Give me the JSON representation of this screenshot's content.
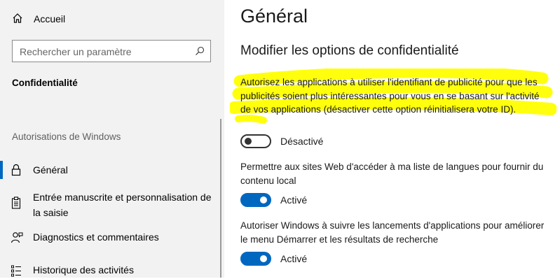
{
  "sidebar": {
    "home_label": "Accueil",
    "search_placeholder": "Rechercher un paramètre",
    "section_title": "Confidentialité",
    "group_title": "Autorisations de Windows",
    "items": [
      {
        "label": "Général",
        "icon": "lock-icon",
        "active": true
      },
      {
        "label": "Entrée manuscrite et personnalisation de la saisie",
        "icon": "clipboard-icon"
      },
      {
        "label": "Diagnostics et commentaires",
        "icon": "feedback-person-icon"
      },
      {
        "label": "Historique des activités",
        "icon": "activity-history-icon"
      }
    ]
  },
  "main": {
    "title": "Général",
    "subtitle": "Modifier les options de confidentialité",
    "options": [
      {
        "description": "Autorisez les applications à utiliser l'identifiant de publicité pour que les publicités soient plus intéressantes pour vous en se basant sur l'activité de vos applications (désactiver cette option réinitialisera votre ID).",
        "state_label": "Désactivé",
        "on": false,
        "highlighted": true
      },
      {
        "description": "Permettre aux sites Web d'accéder à ma liste de langues pour fournir du contenu local",
        "state_label": "Activé",
        "on": true
      },
      {
        "description": "Autoriser Windows à suivre les lancements d'applications pour améliorer le menu Démarrer et les résultats de recherche",
        "state_label": "Activé",
        "on": true
      }
    ]
  },
  "colors": {
    "accent": "#0067c0",
    "highlight": "#ffff00",
    "sidebar_bg": "#f2f2f2"
  }
}
